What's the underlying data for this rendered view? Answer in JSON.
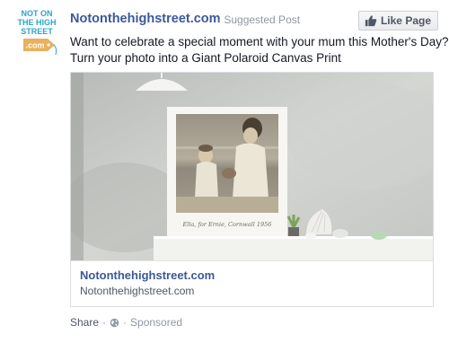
{
  "post": {
    "logo_lines": [
      "NOT ON",
      "THE HIGH",
      "STREET",
      ".com"
    ],
    "page_name": "Notonthehighstreet.com",
    "separator": "·",
    "suggested": "Suggested Post",
    "like_label": "Like Page",
    "caption_line1": "Want to celebrate a special moment with your mum this Mother's Day?",
    "caption_line2": "Turn your photo into a Giant Polaroid Canvas Print",
    "polaroid_note": "Ella, for Ernie, Cornwall 1956"
  },
  "card": {
    "title": "Notonthehighstreet.com",
    "domain": "Notonthehighstreet.com"
  },
  "footer": {
    "share": "Share",
    "dot1": "·",
    "dot2": "·",
    "sponsored": "Sponsored"
  },
  "icons": {
    "thumb": "thumbs-up-icon",
    "globe": "globe-icon"
  },
  "colors": {
    "link": "#3b5998",
    "logo_blue": "#2aa5c9",
    "logo_tag": "#e8b15c",
    "meta_gray": "#9197a3"
  }
}
